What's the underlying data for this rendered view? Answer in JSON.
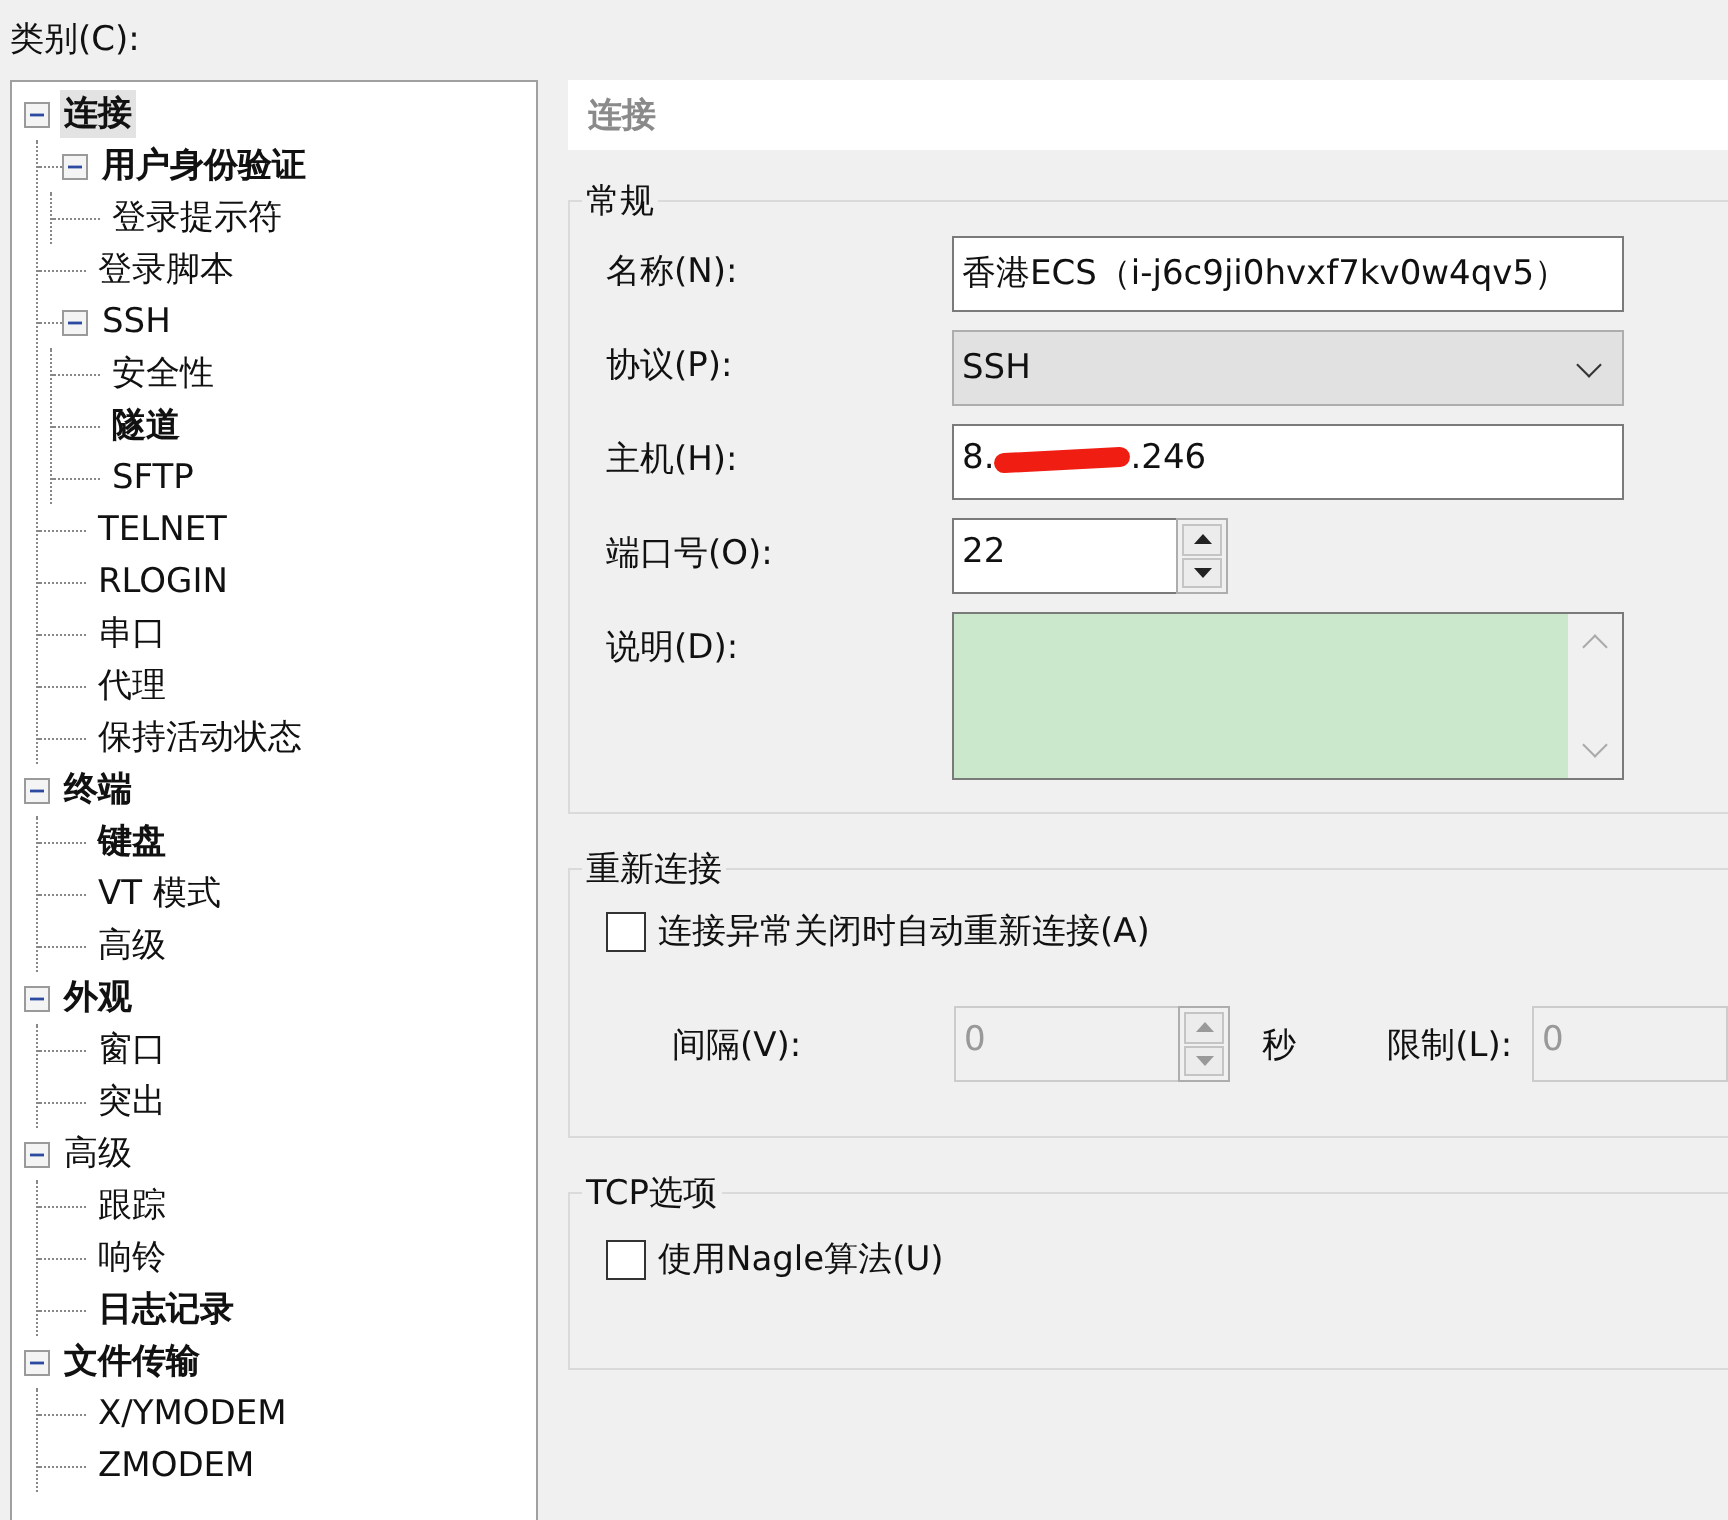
{
  "category_label": "类别(C):",
  "tree": [
    {
      "label": "连接",
      "bold": true,
      "selected": true,
      "expanded": true,
      "children": [
        {
          "label": "用户身份验证",
          "bold": true,
          "selected": false,
          "expanded": true,
          "children": [
            {
              "label": "登录提示符",
              "bold": false,
              "selected": false
            }
          ]
        },
        {
          "label": "登录脚本",
          "bold": false,
          "selected": false
        },
        {
          "label": "SSH",
          "bold": false,
          "selected": false,
          "expanded": true,
          "children": [
            {
              "label": "安全性",
              "bold": false,
              "selected": false
            },
            {
              "label": "隧道",
              "bold": true,
              "selected": false
            },
            {
              "label": "SFTP",
              "bold": false,
              "selected": false
            }
          ]
        },
        {
          "label": "TELNET",
          "bold": false,
          "selected": false
        },
        {
          "label": "RLOGIN",
          "bold": false,
          "selected": false
        },
        {
          "label": "串口",
          "bold": false,
          "selected": false
        },
        {
          "label": "代理",
          "bold": false,
          "selected": false
        },
        {
          "label": "保持活动状态",
          "bold": false,
          "selected": false
        }
      ]
    },
    {
      "label": "终端",
      "bold": true,
      "selected": false,
      "expanded": true,
      "children": [
        {
          "label": "键盘",
          "bold": true,
          "selected": false
        },
        {
          "label": "VT 模式",
          "bold": false,
          "selected": false
        },
        {
          "label": "高级",
          "bold": false,
          "selected": false
        }
      ]
    },
    {
      "label": "外观",
      "bold": true,
      "selected": false,
      "expanded": true,
      "children": [
        {
          "label": "窗口",
          "bold": false,
          "selected": false
        },
        {
          "label": "突出",
          "bold": false,
          "selected": false
        }
      ]
    },
    {
      "label": "高级",
      "bold": false,
      "selected": false,
      "expanded": true,
      "children": [
        {
          "label": "跟踪",
          "bold": false,
          "selected": false
        },
        {
          "label": "响铃",
          "bold": false,
          "selected": false
        },
        {
          "label": "日志记录",
          "bold": true,
          "selected": false
        }
      ]
    },
    {
      "label": "文件传输",
      "bold": true,
      "selected": false,
      "expanded": true,
      "children": [
        {
          "label": "X/YMODEM",
          "bold": false,
          "selected": false
        },
        {
          "label": "ZMODEM",
          "bold": false,
          "selected": false
        }
      ]
    }
  ],
  "panel": {
    "title": "连接"
  },
  "general": {
    "title": "常规",
    "fields": [
      {
        "kind": "text",
        "label": "名称(N):",
        "value": "香港ECS（i-j6c9ji0hvxf7kv0w4qv5）"
      },
      {
        "kind": "dropdown",
        "label": "协议(P):",
        "value": "SSH"
      },
      {
        "kind": "redacted",
        "label": "主机(H):",
        "value_start": "8.",
        "value_end": ".246"
      },
      {
        "kind": "spin",
        "label": "端口号(O):",
        "value": "22"
      },
      {
        "kind": "memo",
        "label": "说明(D):"
      }
    ]
  },
  "reconnect": {
    "title": "重新连接",
    "checkbox": {
      "label": "连接异常关闭时自动重新连接(A)",
      "checked": false
    },
    "interval": {
      "label": "间隔(V):",
      "value": "0",
      "unit": "秒",
      "disabled": true
    },
    "limit": {
      "label": "限制(L):",
      "value": "0",
      "disabled": true
    }
  },
  "tcp": {
    "title": "TCP选项",
    "checkbox": {
      "label": "使用Nagle算法(U)",
      "checked": false
    }
  }
}
